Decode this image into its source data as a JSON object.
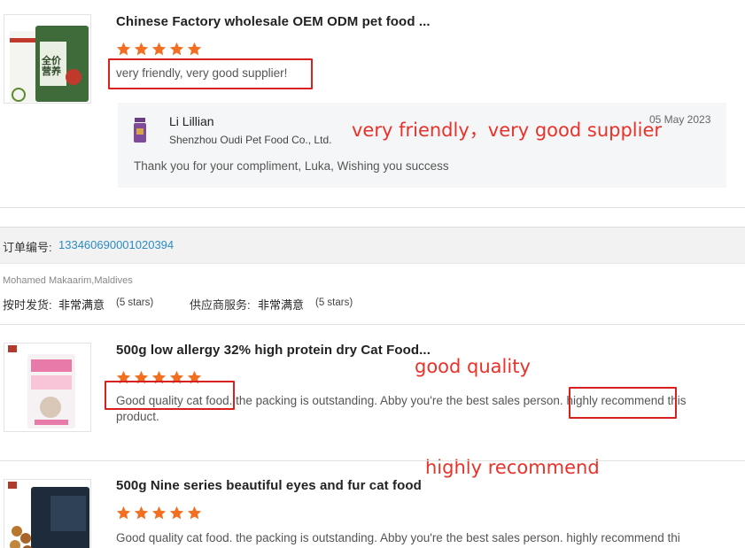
{
  "review1": {
    "title": "Chinese Factory wholesale OEM ODM pet food ...",
    "rating": 5,
    "text": "very friendly, very good supplier!",
    "annotation": "very friendly，very good supplier",
    "product_image_text": "全价营养",
    "reply": {
      "name": "Li Lillian",
      "company": "Shenzhou Oudi Pet Food Co., Ltd.",
      "date": "05 May 2023",
      "text": "Thank you for your compliment, Luka,  Wishing you success"
    }
  },
  "order": {
    "label": "订单编号:",
    "number": "133460690001020394"
  },
  "buyer": {
    "name": "Mohamed Makaarim,Maldives",
    "shipping_label": "按时发货:",
    "shipping_value": "非常满意",
    "shipping_stars": "(5 stars)",
    "service_label": "供应商服务:",
    "service_value": "非常满意",
    "service_stars": "(5 stars)"
  },
  "review2": {
    "title": "500g low allergy 32% high protein dry Cat Food...",
    "rating": 5,
    "text_highlight1": "Good quality cat food",
    "text_middle": ". the packing is outstanding. Abby you're the best sales person.",
    "text_highlight2": "highly recommend",
    "text_end": " this product.",
    "annotation1": "good quality",
    "annotation2": "highly recommend"
  },
  "review3": {
    "title": "500g Nine series beautiful eyes and fur cat food",
    "rating": 5,
    "text": "Good quality cat food. the packing is outstanding. Abby you're the best sales person. highly recommend thi"
  },
  "colors": {
    "star": "#f26f21",
    "annotation_red": "#e8322a",
    "link_blue": "#2b8bc6"
  }
}
